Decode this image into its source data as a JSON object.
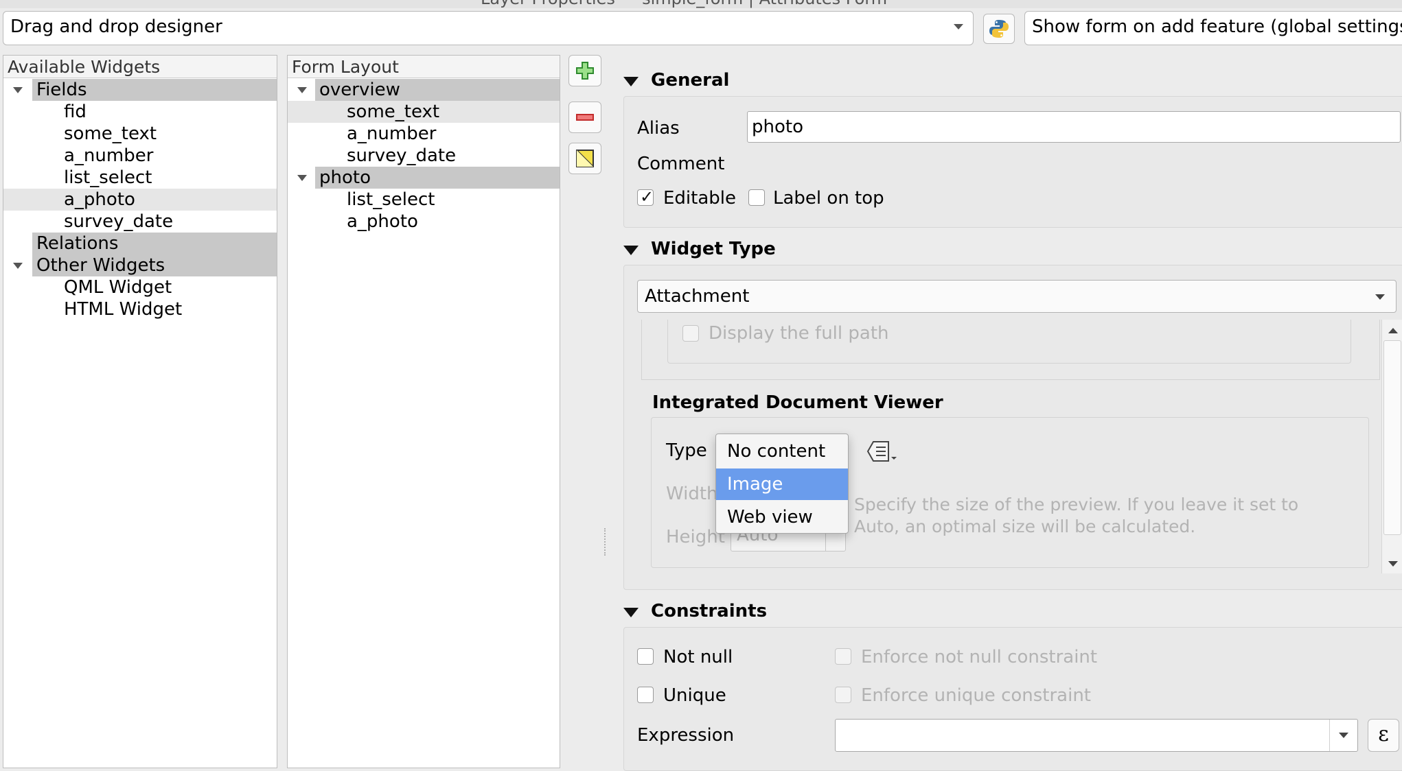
{
  "window": {
    "title": "Layer Properties — simple_form | Attributes Form"
  },
  "toolbar": {
    "editor_mode": "Drag and drop designer",
    "python_icon": "python-icon",
    "suppress_mode": "Show form on add feature (global settings)"
  },
  "available_widgets": {
    "header": "Available Widgets",
    "fields_group": "Fields",
    "fields": [
      "fid",
      "some_text",
      "a_number",
      "list_select",
      "a_photo",
      "survey_date"
    ],
    "relations_group": "Relations",
    "other_group": "Other Widgets",
    "other": [
      "QML Widget",
      "HTML Widget"
    ]
  },
  "form_layout": {
    "header": "Form Layout",
    "tabs": [
      {
        "label": "overview",
        "items": [
          "some_text",
          "a_number",
          "survey_date"
        ]
      },
      {
        "label": "photo",
        "items": [
          "list_select",
          "a_photo"
        ]
      }
    ]
  },
  "side_buttons": [
    "add-icon",
    "remove-icon",
    "invert-selection-icon"
  ],
  "general": {
    "title": "General",
    "alias_label": "Alias",
    "alias_value": "photo",
    "comment_label": "Comment",
    "editable_label": "Editable",
    "editable_checked": true,
    "label_on_top_label": "Label on top",
    "label_on_top_checked": false
  },
  "widget_type": {
    "title": "Widget Type",
    "selected": "Attachment",
    "display_full_path": "Display the full path",
    "viewer_title": "Integrated Document Viewer",
    "type_label": "Type",
    "width_label": "Width",
    "height_label": "Height",
    "height_value": "Auto",
    "hint": "Specify the size of the preview. If you leave it set to Auto, an optimal size will be calculated.",
    "dropdown_options": [
      "No content",
      "Image",
      "Web view"
    ],
    "dropdown_highlighted": "Image",
    "selection_color": "#6a9cec"
  },
  "constraints": {
    "title": "Constraints",
    "not_null_label": "Not null",
    "enforce_not_null_label": "Enforce not null constraint",
    "unique_label": "Unique",
    "enforce_unique_label": "Enforce unique constraint",
    "expression_label": "Expression",
    "expression_value": ""
  }
}
